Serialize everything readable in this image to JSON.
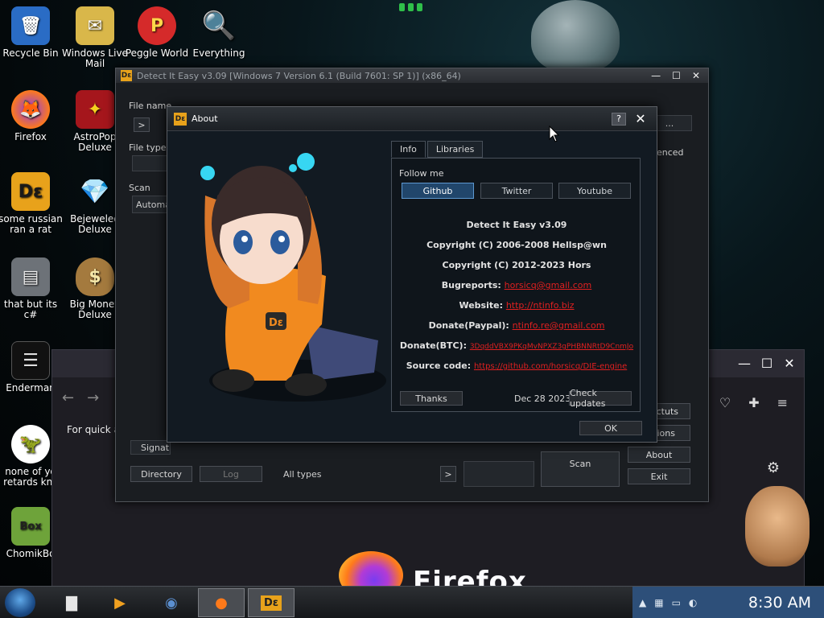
{
  "desktop": {
    "icons": [
      {
        "label": "Recycle Bin",
        "glyph": "🗑"
      },
      {
        "label": "Windows Live Mail",
        "glyph": "✉"
      },
      {
        "label": "Peggle World",
        "glyph": "P"
      },
      {
        "label": "Everything",
        "glyph": "🔍"
      },
      {
        "label": "Firefox",
        "glyph": "🦊"
      },
      {
        "label": "AstroPop Deluxe",
        "glyph": "✦"
      },
      {
        "label": "some russian ran a rat",
        "glyph": "Dε"
      },
      {
        "label": "Bejeweled Deluxe",
        "glyph": "💎"
      },
      {
        "label": "that but its c#",
        "glyph": "▤"
      },
      {
        "label": "Big Money Deluxe",
        "glyph": "$"
      },
      {
        "label": "Enderman",
        "glyph": "☰"
      },
      {
        "label": "none of yo retards knc",
        "glyph": "🦖"
      },
      {
        "label": "ChomikBo",
        "glyph": "Box"
      }
    ]
  },
  "firefox_window": {
    "quick_text": "For quick a",
    "wordmark": "Firefox"
  },
  "die_window": {
    "title": "Detect It Easy v3.09 [Windows 7 Version 6.1 (Build 7601: SP 1)] (x86_64)",
    "file_name_label": "File name",
    "file_type_label": "File type",
    "scan_label": "Scan",
    "scan_value": "Automa",
    "advanced_label": "enced",
    "browse_label": "...",
    "arrow_label": ">",
    "signat_label": "Signat",
    "directory_label": "Directory",
    "log_label": "Log",
    "all_types_label": "All types",
    "scan_button": "Scan",
    "shortcuts_button": "ctuts",
    "options_button": "ions",
    "about_button": "About",
    "exit_button": "Exit",
    "icon_text": "Dε"
  },
  "about": {
    "title": "About",
    "help_label": "?",
    "tabs": [
      "Info",
      "Libraries"
    ],
    "follow_label": "Follow me",
    "social": [
      "Github",
      "Twitter",
      "Youtube"
    ],
    "product": "Detect It Easy v3.09",
    "copyright1": "Copyright (C) 2006-2008 Hellsp@wn",
    "copyright2": "Copyright (C) 2012-2023 Hors",
    "bugreports_label": "Bugreports:",
    "bugreports_value": "horsicq@gmail.com",
    "website_label": "Website:",
    "website_value": "http://ntinfo.biz",
    "paypal_label": "Donate(Paypal):",
    "paypal_value": "ntinfo.re@gmail.com",
    "btc_label": "Donate(BTC):",
    "btc_value": "3DqddVBX9PKqMvNPXZ3gPHBNNRtD9CnmJo",
    "source_label": "Source code:",
    "source_value": "https://github.com/horsicq/DIE-engine",
    "thanks_button": "Thanks",
    "date": "Dec 28 2023",
    "check_updates_button": "Check updates",
    "ok_button": "OK"
  },
  "taskbar": {
    "clock": "8:30 AM",
    "tray_arrow": "▲"
  }
}
